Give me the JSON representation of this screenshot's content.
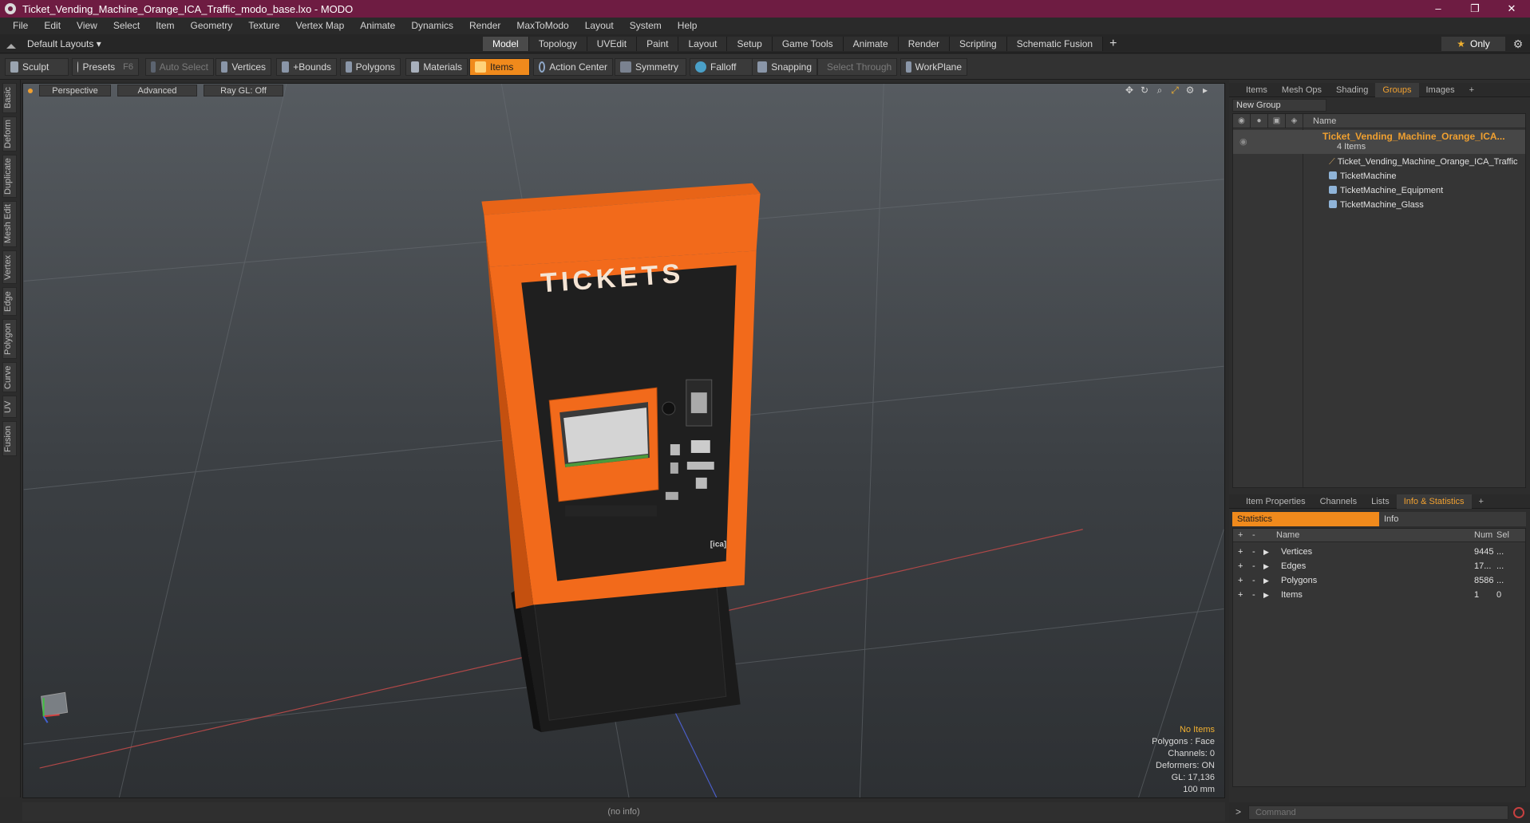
{
  "window": {
    "title": "Ticket_Vending_Machine_Orange_ICA_Traffic_modo_base.lxo - MODO",
    "minimize": "–",
    "maximize": "❐",
    "close": "✕"
  },
  "menu": [
    "File",
    "Edit",
    "View",
    "Select",
    "Item",
    "Geometry",
    "Texture",
    "Vertex Map",
    "Animate",
    "Dynamics",
    "Render",
    "MaxToModo",
    "Layout",
    "System",
    "Help"
  ],
  "layout": {
    "selector": "Default Layouts ▾",
    "tabs": [
      "Model",
      "Topology",
      "UVEdit",
      "Paint",
      "Layout",
      "Setup",
      "Game Tools",
      "Animate",
      "Render",
      "Scripting",
      "Schematic Fusion"
    ],
    "active_tab": "Model",
    "only_label": "Only"
  },
  "toolbar": {
    "sculpt": "Sculpt",
    "presets": "Presets",
    "presets_key": "F6",
    "auto_select": "Auto Select",
    "vertices": "Vertices",
    "bounds": "+Bounds",
    "polygons": "Polygons",
    "materials": "Materials",
    "items": "Items",
    "action_center": "Action Center",
    "symmetry": "Symmetry",
    "falloff": "Falloff",
    "snapping": "Snapping",
    "select_through": "Select Through",
    "workplane": "WorkPlane"
  },
  "left_tabs": [
    "Basic",
    "Deform",
    "Duplicate",
    "Mesh Edit",
    "Vertex",
    "Edge",
    "Polygon",
    "Curve",
    "UV",
    "Fusion"
  ],
  "viewport": {
    "view_mode": "Perspective",
    "shading": "Advanced",
    "ray_gl": "Ray GL: Off",
    "sign_text": "TICKETS",
    "logo_text": "[ica]",
    "info": {
      "selection": "No Items",
      "polygons": "Polygons : Face",
      "channels": "Channels: 0",
      "deformers": "Deformers: ON",
      "gl": "GL: 17,136",
      "scale": "100 mm"
    }
  },
  "status_bar": "(no info)",
  "groups_panel": {
    "tabs": [
      "Items",
      "Mesh Ops",
      "Shading",
      "Groups",
      "Images"
    ],
    "active_tab": "Groups",
    "new_group": "New Group",
    "name_header": "Name",
    "group_name": "Ticket_Vending_Machine_Orange_ICA...",
    "group_count": "4 Items",
    "children": [
      "Ticket_Vending_Machine_Orange_ICA_Traffic",
      "TicketMachine",
      "TicketMachine_Equipment",
      "TicketMachine_Glass"
    ]
  },
  "info_panel": {
    "tabs": [
      "Item Properties",
      "Channels",
      "Lists",
      "Info & Statistics"
    ],
    "active_tab": "Info & Statistics",
    "sub_tabs": [
      "Statistics",
      "Info"
    ],
    "headers": {
      "name": "Name",
      "num": "Num",
      "sel": "Sel"
    },
    "rows": [
      {
        "name": "Vertices",
        "num": "9445",
        "sel": "..."
      },
      {
        "name": "Edges",
        "num": "17...",
        "sel": "..."
      },
      {
        "name": "Polygons",
        "num": "8586",
        "sel": "..."
      },
      {
        "name": "Items",
        "num": "1",
        "sel": "0"
      }
    ]
  },
  "command": {
    "prompt": ">",
    "placeholder": "Command"
  },
  "colors": {
    "accent": "#f08a1c",
    "titlebar": "#6e1c42",
    "machine_orange": "#f26a1b"
  }
}
